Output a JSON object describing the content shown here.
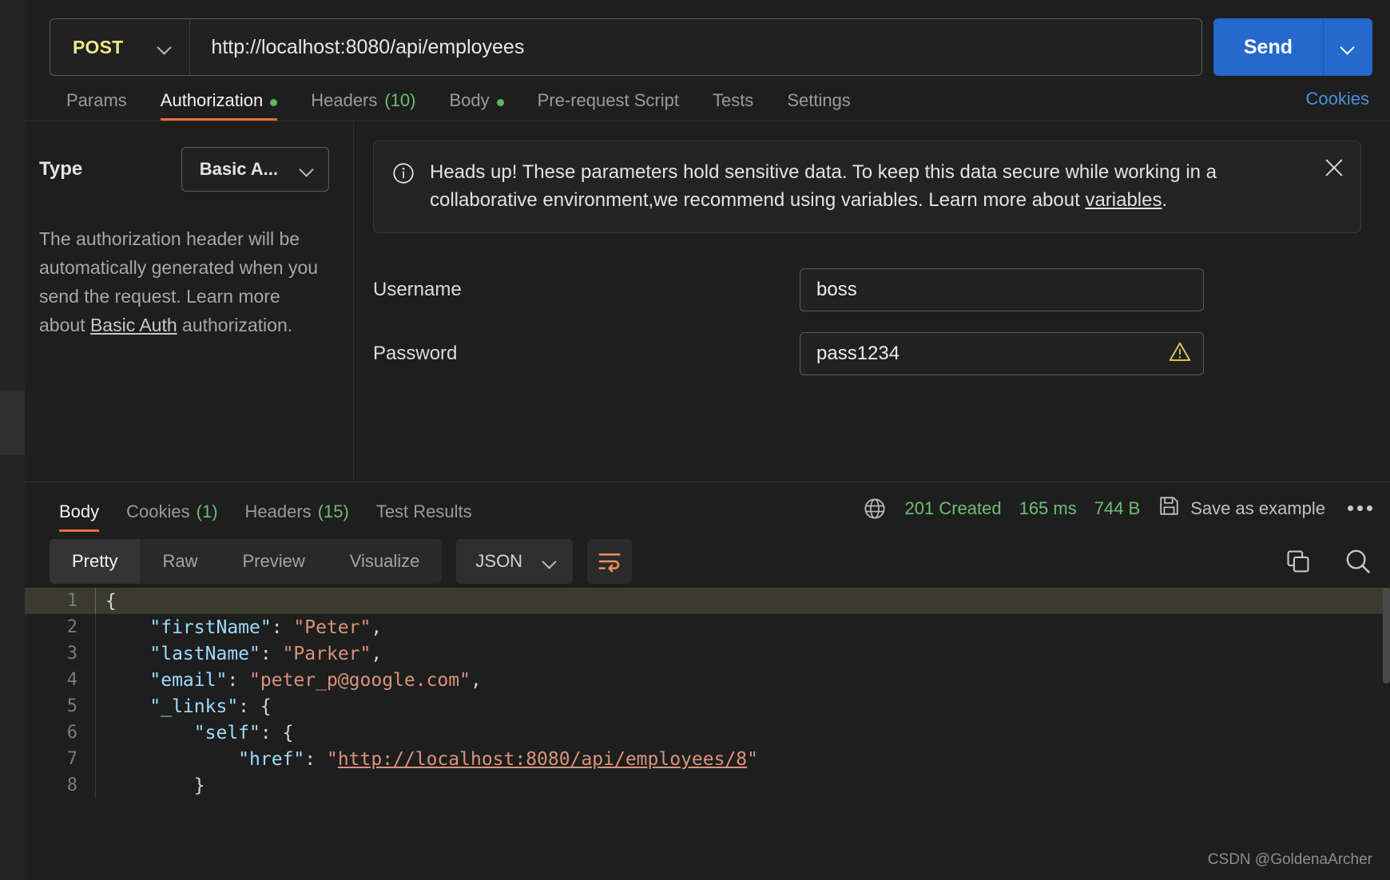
{
  "request": {
    "method": "POST",
    "url": "http://localhost:8080/api/employees",
    "send_label": "Send",
    "tabs": [
      {
        "label": "Params",
        "badge": "",
        "dot": false,
        "active": false
      },
      {
        "label": "Authorization",
        "badge": "",
        "dot": true,
        "active": true
      },
      {
        "label": "Headers",
        "badge": "(10)",
        "dot": false,
        "active": false
      },
      {
        "label": "Body",
        "badge": "",
        "dot": true,
        "active": false
      },
      {
        "label": "Pre-request Script",
        "badge": "",
        "dot": false,
        "active": false
      },
      {
        "label": "Tests",
        "badge": "",
        "dot": false,
        "active": false
      },
      {
        "label": "Settings",
        "badge": "",
        "dot": false,
        "active": false
      }
    ],
    "cookies_link": "Cookies"
  },
  "auth": {
    "type_label": "Type",
    "type_value": "Basic A...",
    "description_pre": "The authorization header will be automatically generated when you send the request. Learn more about ",
    "description_link": "Basic Auth",
    "description_post": " authorization.",
    "notice": {
      "text_pre": "Heads up! These parameters hold sensitive data. To keep this data secure while working in a collaborative environment,we recommend using variables. Learn more about ",
      "link": "variables",
      "text_post": "."
    },
    "username_label": "Username",
    "username_value": "boss",
    "password_label": "Password",
    "password_value": "pass1234"
  },
  "response": {
    "tabs": [
      {
        "label": "Body",
        "badge": "",
        "active": true
      },
      {
        "label": "Cookies",
        "badge": "(1)",
        "active": false
      },
      {
        "label": "Headers",
        "badge": "(15)",
        "active": false
      },
      {
        "label": "Test Results",
        "badge": "",
        "active": false
      }
    ],
    "status": "201 Created",
    "time": "165 ms",
    "size": "744 B",
    "save_as_example": "Save as example",
    "format_tabs": [
      {
        "label": "Pretty",
        "active": true
      },
      {
        "label": "Raw",
        "active": false
      },
      {
        "label": "Preview",
        "active": false
      },
      {
        "label": "Visualize",
        "active": false
      }
    ],
    "language": "JSON"
  },
  "code_lines": [
    {
      "n": "1",
      "highlight": true,
      "tokens": [
        {
          "t": "{",
          "c": "p"
        }
      ]
    },
    {
      "n": "2",
      "highlight": false,
      "tokens": [
        {
          "t": "    \"firstName\"",
          "c": "k"
        },
        {
          "t": ": ",
          "c": "p"
        },
        {
          "t": "\"Peter\"",
          "c": "s"
        },
        {
          "t": ",",
          "c": "p"
        }
      ]
    },
    {
      "n": "3",
      "highlight": false,
      "tokens": [
        {
          "t": "    \"lastName\"",
          "c": "k"
        },
        {
          "t": ": ",
          "c": "p"
        },
        {
          "t": "\"Parker\"",
          "c": "s"
        },
        {
          "t": ",",
          "c": "p"
        }
      ]
    },
    {
      "n": "4",
      "highlight": false,
      "tokens": [
        {
          "t": "    \"email\"",
          "c": "k"
        },
        {
          "t": ": ",
          "c": "p"
        },
        {
          "t": "\"peter_p@google.com\"",
          "c": "s"
        },
        {
          "t": ",",
          "c": "p"
        }
      ]
    },
    {
      "n": "5",
      "highlight": false,
      "tokens": [
        {
          "t": "    \"_links\"",
          "c": "k"
        },
        {
          "t": ": {",
          "c": "p"
        }
      ]
    },
    {
      "n": "6",
      "highlight": false,
      "tokens": [
        {
          "t": "        \"self\"",
          "c": "k"
        },
        {
          "t": ": {",
          "c": "p"
        }
      ]
    },
    {
      "n": "7",
      "highlight": false,
      "tokens": [
        {
          "t": "            \"href\"",
          "c": "k"
        },
        {
          "t": ": ",
          "c": "p"
        },
        {
          "t": "\"",
          "c": "s"
        },
        {
          "t": "http://localhost:8080/api/employees/8",
          "c": "u"
        },
        {
          "t": "\"",
          "c": "s"
        }
      ]
    },
    {
      "n": "8",
      "highlight": false,
      "tokens": [
        {
          "t": "        }",
          "c": "p"
        }
      ]
    }
  ],
  "watermark": "CSDN @GoldenaArcher",
  "colors": {
    "accent_orange": "#ef6c36",
    "send_blue": "#2568ce",
    "link_blue": "#4a90e2",
    "status_green": "#6bbf73",
    "method_yellow": "#f0e68c",
    "warn_yellow": "#e8cb55"
  }
}
